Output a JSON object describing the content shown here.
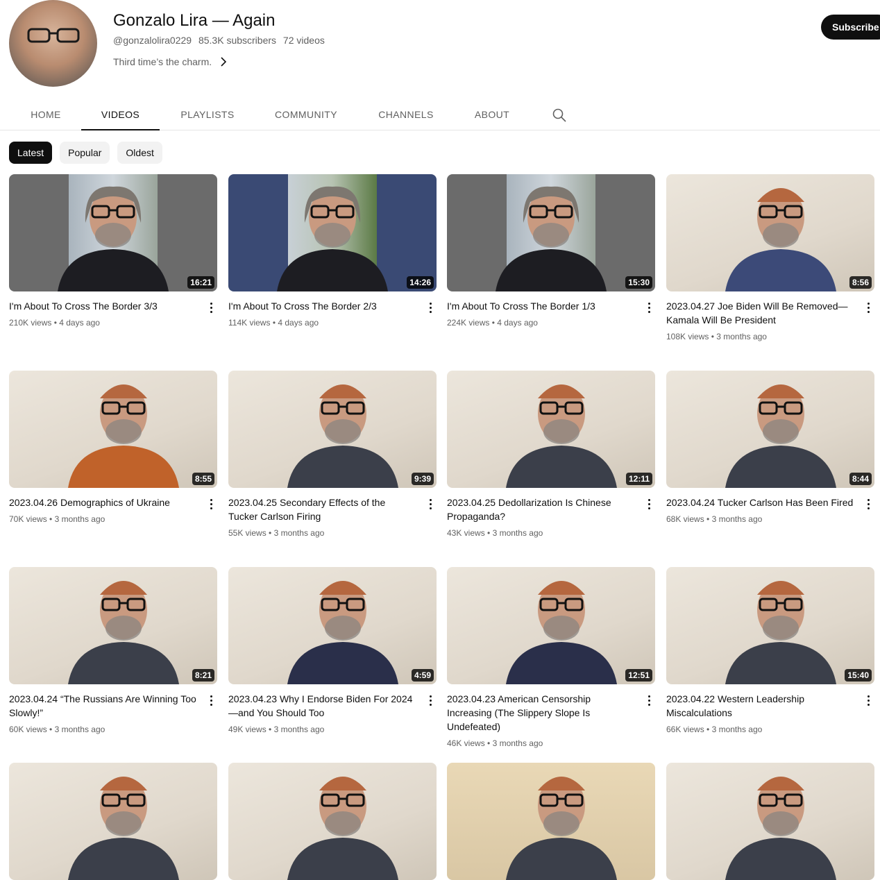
{
  "channel": {
    "name": "Gonzalo Lira — Again",
    "handle": "@gonzalolira0229",
    "subscribers": "85.3K subscribers",
    "video_count": "72 videos",
    "tagline": "Third time’s the charm.",
    "subscribe_label": "Subscribe"
  },
  "tabs": [
    {
      "label": "HOME",
      "active": false
    },
    {
      "label": "VIDEOS",
      "active": true
    },
    {
      "label": "PLAYLISTS",
      "active": false
    },
    {
      "label": "COMMUNITY",
      "active": false
    },
    {
      "label": "CHANNELS",
      "active": false
    },
    {
      "label": "ABOUT",
      "active": false
    }
  ],
  "chips": [
    {
      "label": "Latest",
      "selected": true
    },
    {
      "label": "Popular",
      "selected": false
    },
    {
      "label": "Oldest",
      "selected": false
    }
  ],
  "videos": [
    {
      "title": "I'm About To Cross The Border 3/3",
      "views": "210K views",
      "age": "4 days ago",
      "duration": "16:21",
      "style": "border-gray",
      "shirt": "#1d1d22"
    },
    {
      "title": "I'm About To Cross The Border 2/3",
      "views": "114K views",
      "age": "4 days ago",
      "duration": "14:26",
      "style": "border-blue",
      "shirt": "#1d1d22"
    },
    {
      "title": "I'm About To Cross The Border 1/3",
      "views": "224K views",
      "age": "4 days ago",
      "duration": "15:30",
      "style": "border-gray",
      "shirt": "#1d1d22"
    },
    {
      "title": "2023.04.27 Joe Biden Will Be Removed—Kamala Will Be President",
      "views": "108K views",
      "age": "3 months ago",
      "duration": "8:56",
      "style": "wall",
      "shirt": "#3c4a78"
    },
    {
      "title": "2023.04.26 Demographics of Ukraine",
      "views": "70K views",
      "age": "3 months ago",
      "duration": "8:55",
      "style": "wall",
      "shirt": "#c0622a"
    },
    {
      "title": "2023.04.25 Secondary Effects of the Tucker Carlson Firing",
      "views": "55K views",
      "age": "3 months ago",
      "duration": "9:39",
      "style": "wall",
      "shirt": "#3b3f4a"
    },
    {
      "title": "2023.04.25 Dedollarization Is Chinese Propaganda?",
      "views": "43K views",
      "age": "3 months ago",
      "duration": "12:11",
      "style": "wall",
      "shirt": "#3b3f4a"
    },
    {
      "title": "2023.04.24 Tucker Carlson Has Been Fired",
      "views": "68K views",
      "age": "3 months ago",
      "duration": "8:44",
      "style": "wall",
      "shirt": "#3b3f4a"
    },
    {
      "title": "2023.04.24 “The Russians Are Winning Too Slowly!”",
      "views": "60K views",
      "age": "3 months ago",
      "duration": "8:21",
      "style": "wall",
      "shirt": "#3b3f4a"
    },
    {
      "title": "2023.04.23 Why I Endorse Biden For 2024—and You Should Too",
      "views": "49K views",
      "age": "3 months ago",
      "duration": "4:59",
      "style": "wall",
      "shirt": "#2a2f4a"
    },
    {
      "title": "2023.04.23 American Censorship Increasing (The Slippery Slope Is Undefeated)",
      "views": "46K views",
      "age": "3 months ago",
      "duration": "12:51",
      "style": "wall",
      "shirt": "#2a2f4a"
    },
    {
      "title": "2023.04.22 Western Leadership Miscalculations",
      "views": "66K views",
      "age": "3 months ago",
      "duration": "15:40",
      "style": "wall",
      "shirt": "#3b3f4a"
    },
    {
      "title": "",
      "views": "",
      "age": "",
      "duration": "",
      "style": "wall",
      "shirt": "#3b3f4a"
    },
    {
      "title": "",
      "views": "",
      "age": "",
      "duration": "",
      "style": "wall",
      "shirt": "#3b3f4a"
    },
    {
      "title": "",
      "views": "",
      "age": "",
      "duration": "",
      "style": "wall-orange",
      "shirt": "#3b3f4a"
    },
    {
      "title": "",
      "views": "",
      "age": "",
      "duration": "",
      "style": "wall",
      "shirt": "#3b3f4a"
    }
  ],
  "icons": {
    "chevron": "chevron-right-icon",
    "search": "search-icon",
    "more": "more-vert-icon"
  }
}
